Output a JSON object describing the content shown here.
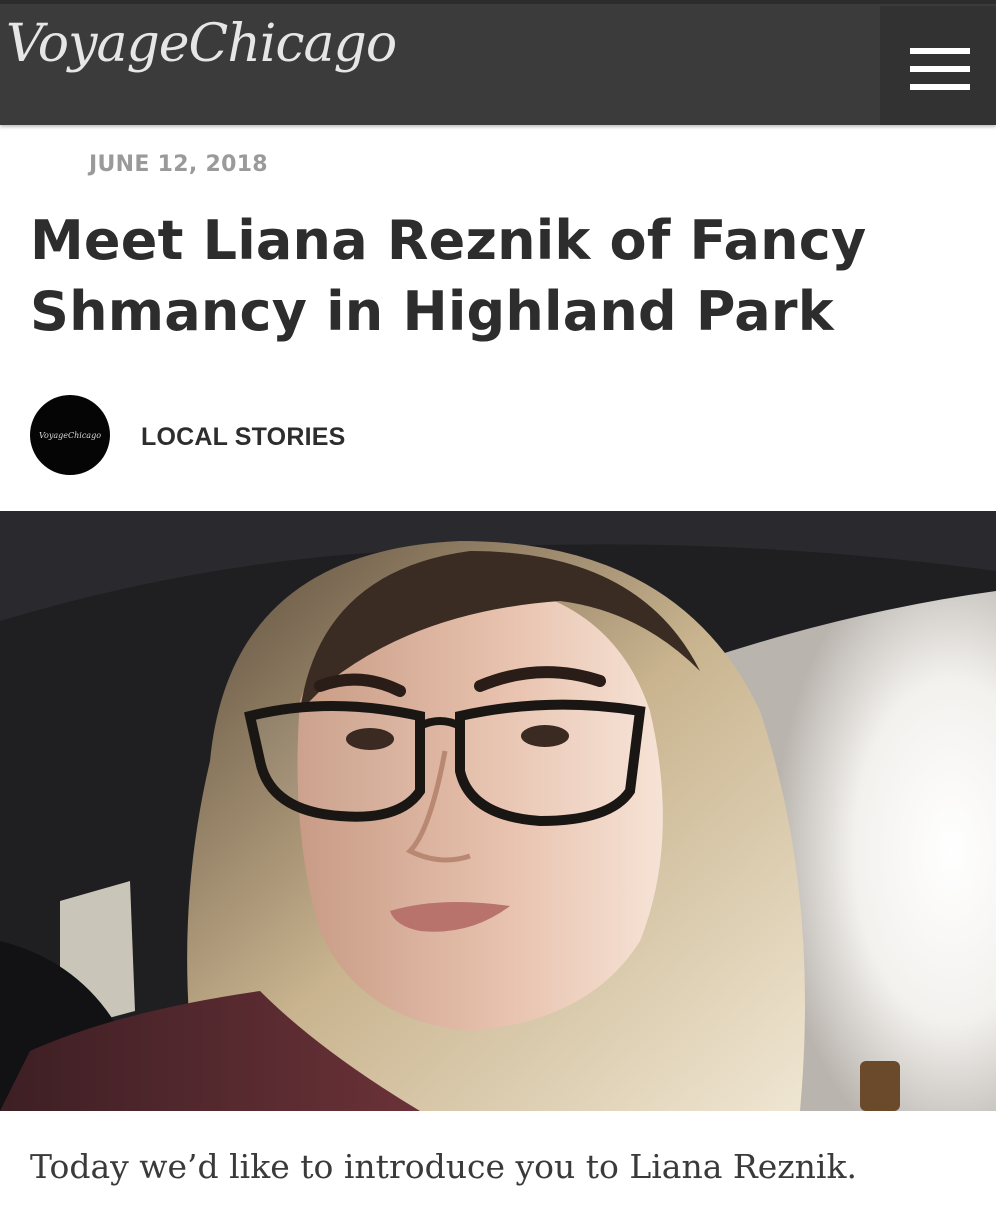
{
  "header": {
    "logo_text": "VoyageChicago",
    "menu_icon": "hamburger-menu-icon",
    "background_color": "#3b3b3b"
  },
  "article": {
    "date": "JUNE 12, 2018",
    "title": "Meet Liana Reznik of Fancy Shmancy in Highland Park",
    "author_avatar_text": "VoyageChicago",
    "category": "LOCAL STORIES",
    "intro": "Today we’d like to introduce you to Liana Reznik."
  }
}
